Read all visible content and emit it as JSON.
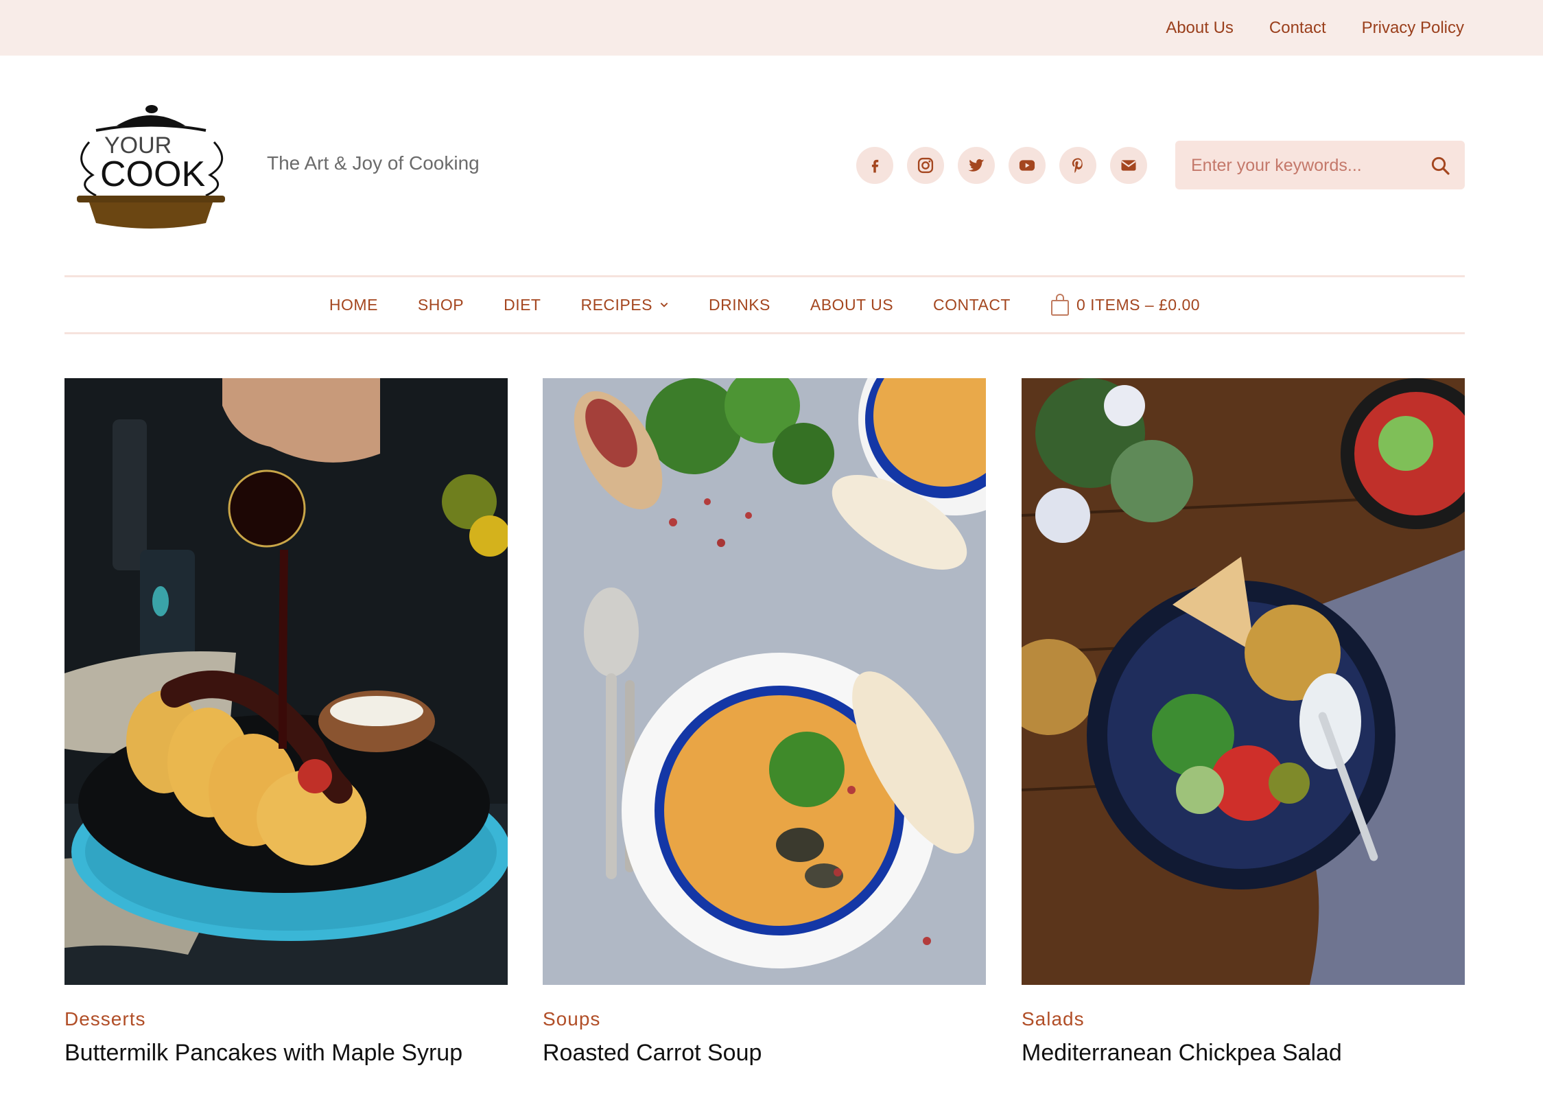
{
  "top_links": [
    "About Us",
    "Contact",
    "Privacy Policy"
  ],
  "logo": {
    "line1": "YOUR",
    "line2": "COOK"
  },
  "tagline": "The Art & Joy of Cooking",
  "socials": [
    "facebook-icon",
    "instagram-icon",
    "twitter-icon",
    "youtube-icon",
    "pinterest-icon",
    "email-icon"
  ],
  "search": {
    "placeholder": "Enter your keywords..."
  },
  "nav": {
    "items": [
      "HOME",
      "SHOP",
      "DIET",
      "RECIPES",
      "DRINKS",
      "ABOUT US",
      "CONTACT"
    ],
    "cart": "0 ITEMS – £0.00"
  },
  "posts": [
    {
      "category": "Desserts",
      "title": "Buttermilk Pancakes with Maple Syrup"
    },
    {
      "category": "Soups",
      "title": "Roasted Carrot Soup"
    },
    {
      "category": "Salads",
      "title": "Mediterranean Chickpea Salad"
    }
  ],
  "colors": {
    "accent": "#a4461f",
    "topbar": "#f8ece8",
    "soft": "#f6e3dd"
  }
}
